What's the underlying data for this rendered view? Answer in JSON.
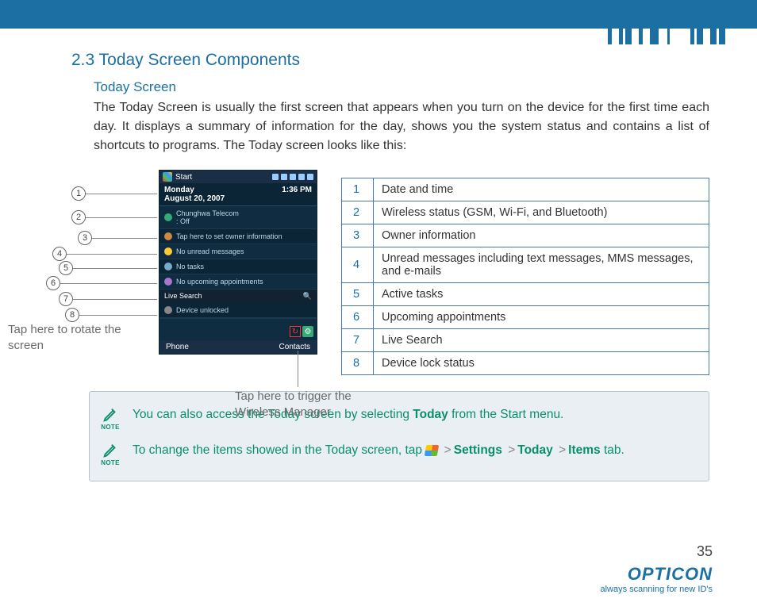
{
  "header": {
    "section_title": "2.3 Today Screen Components",
    "subsection_title": "Today Screen",
    "intro_text": "The Today Screen is usually the first screen that appears when you turn on the device for the first time each day. It displays a summary of information for the day, shows you the system status and contains a list of shortcuts to programs. The Today screen looks like this:"
  },
  "callouts": {
    "rotate_label": "Tap here to rotate the screen",
    "wireless_label": "Tap here to trigger the Wireless Manager",
    "items": [
      {
        "n": "1"
      },
      {
        "n": "2"
      },
      {
        "n": "3"
      },
      {
        "n": "4"
      },
      {
        "n": "5"
      },
      {
        "n": "6"
      },
      {
        "n": "7"
      },
      {
        "n": "8"
      }
    ]
  },
  "phone": {
    "start": "Start",
    "day": "Monday",
    "date": "August 20, 2007",
    "time": "1:36 PM",
    "carrier": "Chunghwa Telecom",
    "carrier_sub": ": Off",
    "owner": "Tap here to set owner information",
    "msgs": "No unread messages",
    "tasks": "No tasks",
    "appts": "No upcoming appointments",
    "search": "Live Search",
    "lock": "Device unlocked",
    "soft_left": "Phone",
    "soft_right": "Contacts"
  },
  "legend": [
    {
      "n": "1",
      "d": "Date and time"
    },
    {
      "n": "2",
      "d": "Wireless status (GSM, Wi-Fi, and Bluetooth)"
    },
    {
      "n": "3",
      "d": "Owner information"
    },
    {
      "n": "4",
      "d": "Unread messages including text messages, MMS messages, and e-mails"
    },
    {
      "n": "5",
      "d": "Active tasks"
    },
    {
      "n": "6",
      "d": "Upcoming appointments"
    },
    {
      "n": "7",
      "d": "Live Search"
    },
    {
      "n": "8",
      "d": "Device lock status"
    }
  ],
  "notes": {
    "note_label": "NOTE",
    "n1_pre": "You can also access the Today screen by selecting ",
    "n1_bold": "Today",
    "n1_post": " from the Start menu.",
    "n2_pre": "To change the items showed in the Today screen, tap ",
    "n2_settings": "Settings",
    "n2_today": "Today",
    "n2_items": "Items",
    "n2_tab": " tab.",
    "gt": ">"
  },
  "footer": {
    "page": "35",
    "brand": "OPTICON",
    "tagline": "always scanning for new ID's"
  }
}
